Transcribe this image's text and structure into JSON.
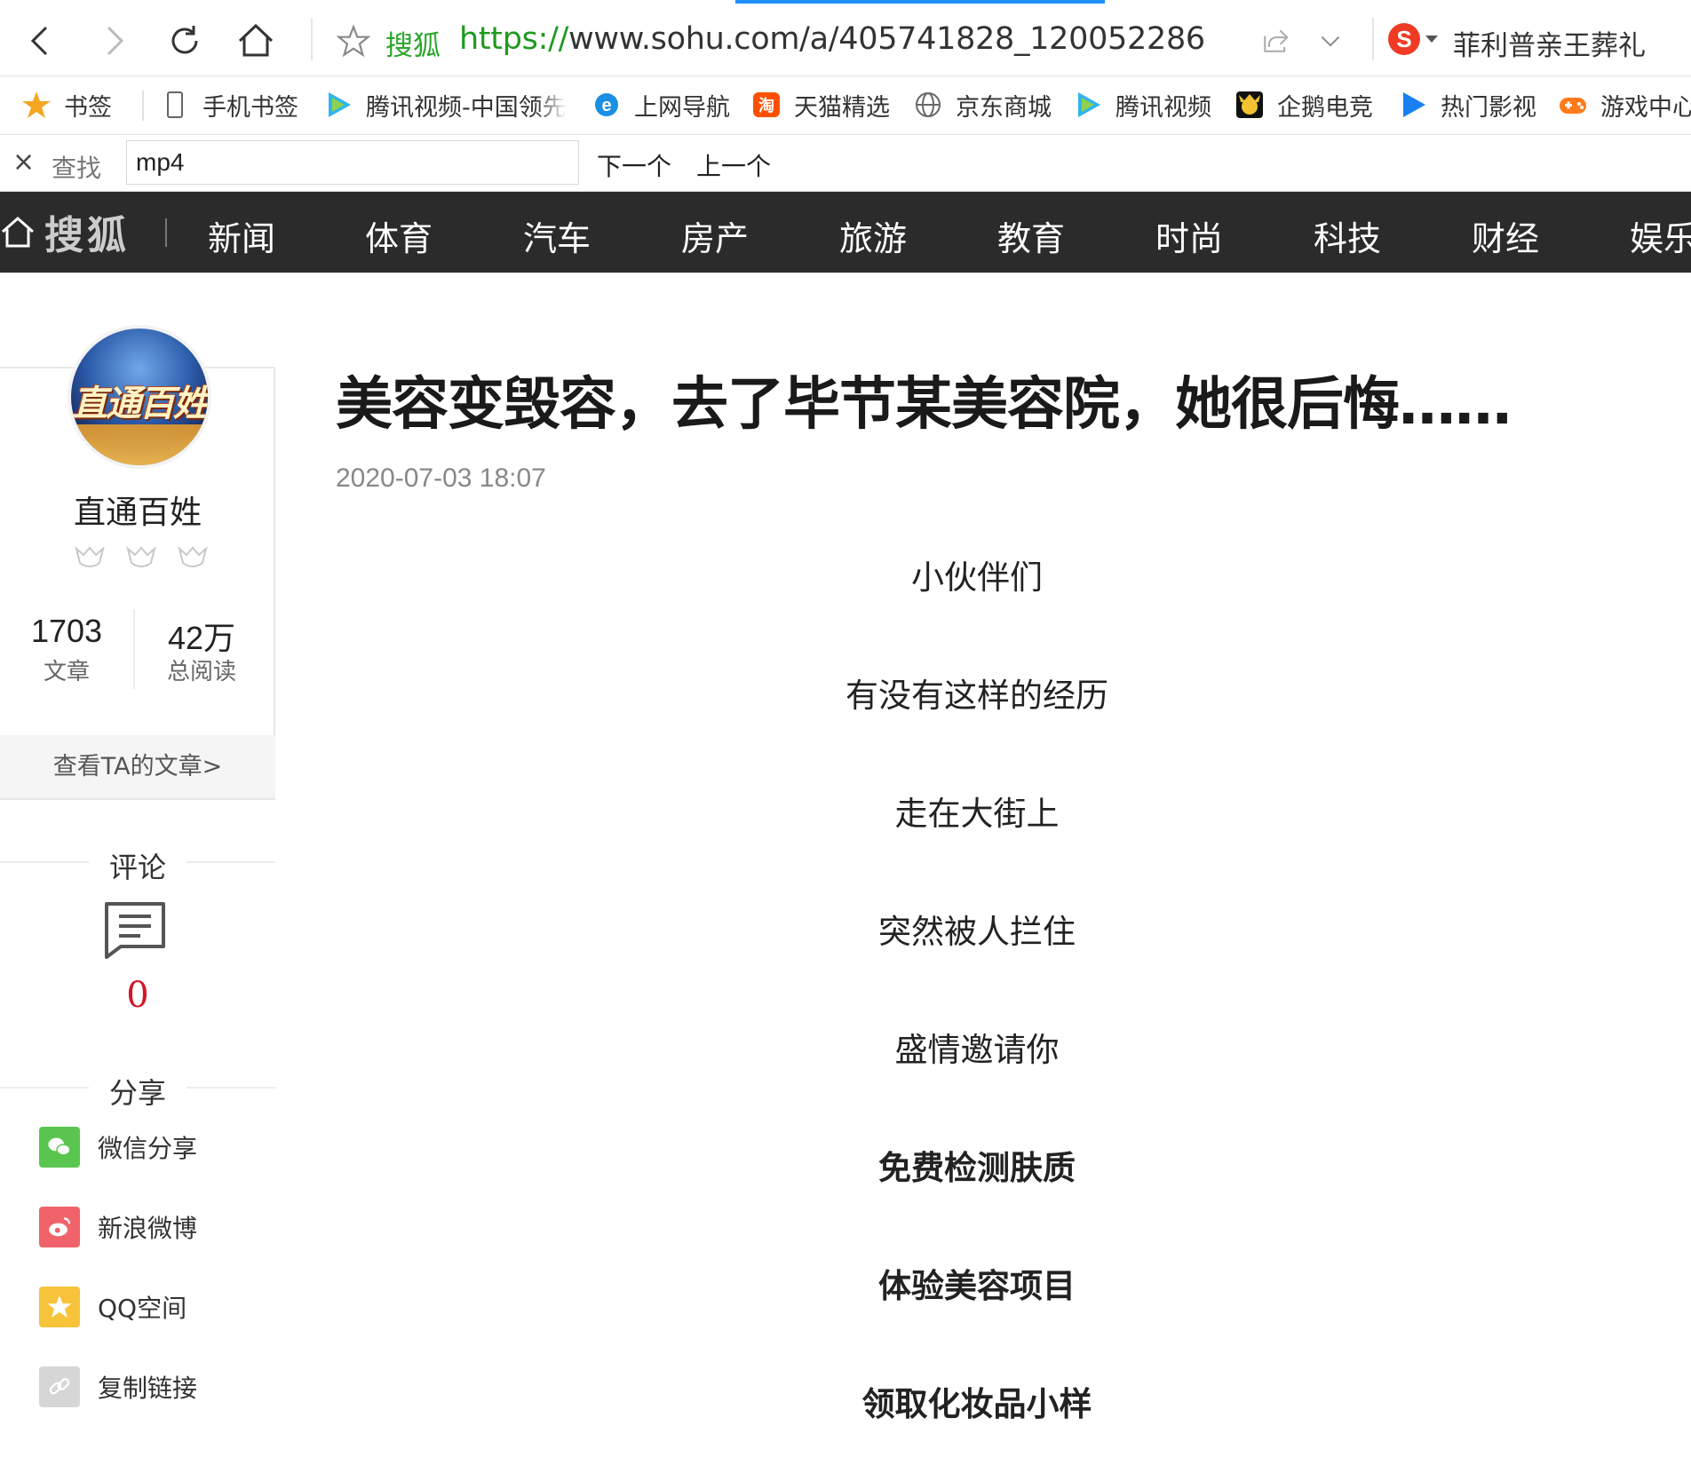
{
  "browser": {
    "site_name": "搜狐",
    "url_protocol": "https://",
    "url_rest": "www.sohu.com/a/405741828_120052286",
    "hot_search": "菲利普亲王葬礼",
    "accent_color": "#1e90ff",
    "url_green": "#1f9a1f"
  },
  "bookmarks": [
    {
      "label": "书签",
      "icon": "star-icon"
    },
    {
      "label": "手机书签",
      "icon": "phone-icon"
    },
    {
      "label": "腾讯视频-中国领先",
      "icon": "tencent-video-icon"
    },
    {
      "label": "上网导航",
      "icon": "ie-icon"
    },
    {
      "label": "天猫精选",
      "icon": "taobao-icon"
    },
    {
      "label": "京东商城",
      "icon": "globe-icon"
    },
    {
      "label": "腾讯视频",
      "icon": "tencent-video-icon"
    },
    {
      "label": "企鹅电竞",
      "icon": "penguin-esports-icon"
    },
    {
      "label": "热门影视",
      "icon": "play-icon"
    },
    {
      "label": "游戏中心",
      "icon": "gamepad-icon"
    }
  ],
  "findbar": {
    "close": "×",
    "label": "查找",
    "query": "mp4",
    "next_label": "下一个",
    "prev_label": "上一个"
  },
  "site_nav": {
    "logo": "搜狐",
    "items": [
      "新闻",
      "体育",
      "汽车",
      "房产",
      "旅游",
      "教育",
      "时尚",
      "科技",
      "财经",
      "娱乐"
    ]
  },
  "author": {
    "avatar_text": "直通百姓",
    "name": "直通百姓",
    "articles_count": "1703",
    "articles_label": "文章",
    "reads_count": "42万",
    "reads_label": "总阅读",
    "view_link": "查看TA的文章>"
  },
  "comments": {
    "title": "评论",
    "count": "0"
  },
  "share": {
    "title": "分享",
    "items": [
      {
        "label": "微信分享",
        "icon": "wechat-icon",
        "color": "#5ac64f"
      },
      {
        "label": "新浪微博",
        "icon": "weibo-icon",
        "color": "#f0636a"
      },
      {
        "label": "QQ空间",
        "icon": "qzone-icon",
        "color": "#f7c33a"
      },
      {
        "label": "复制链接",
        "icon": "link-icon",
        "color": "#d6d6d6"
      }
    ]
  },
  "article": {
    "title": "美容变毁容，去了毕节某美容院，她很后悔……",
    "time": "2020-07-03 18:07",
    "paragraphs": [
      {
        "text": "小伙伴们",
        "bold": false
      },
      {
        "text": "有没有这样的经历",
        "bold": false
      },
      {
        "text": "走在大街上",
        "bold": false
      },
      {
        "text": "突然被人拦住",
        "bold": false
      },
      {
        "text": "盛情邀请你",
        "bold": false
      },
      {
        "text": "免费检测肤质",
        "bold": true
      },
      {
        "text": "体验美容项目",
        "bold": true
      },
      {
        "text": "领取化妆品小样",
        "bold": true
      }
    ]
  }
}
